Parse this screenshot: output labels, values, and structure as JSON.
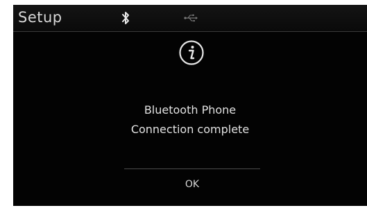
{
  "header": {
    "title": "Setup",
    "icons": [
      "bluetooth-icon",
      "usb-icon"
    ]
  },
  "dialog": {
    "icon": "info-icon",
    "message_line1": "Bluetooth Phone",
    "message_line2": "Connection complete",
    "ok_label": "OK"
  },
  "colors": {
    "screen_bg": "#030303",
    "text": "#e2e2e2",
    "divider": "#4a4a4a"
  }
}
